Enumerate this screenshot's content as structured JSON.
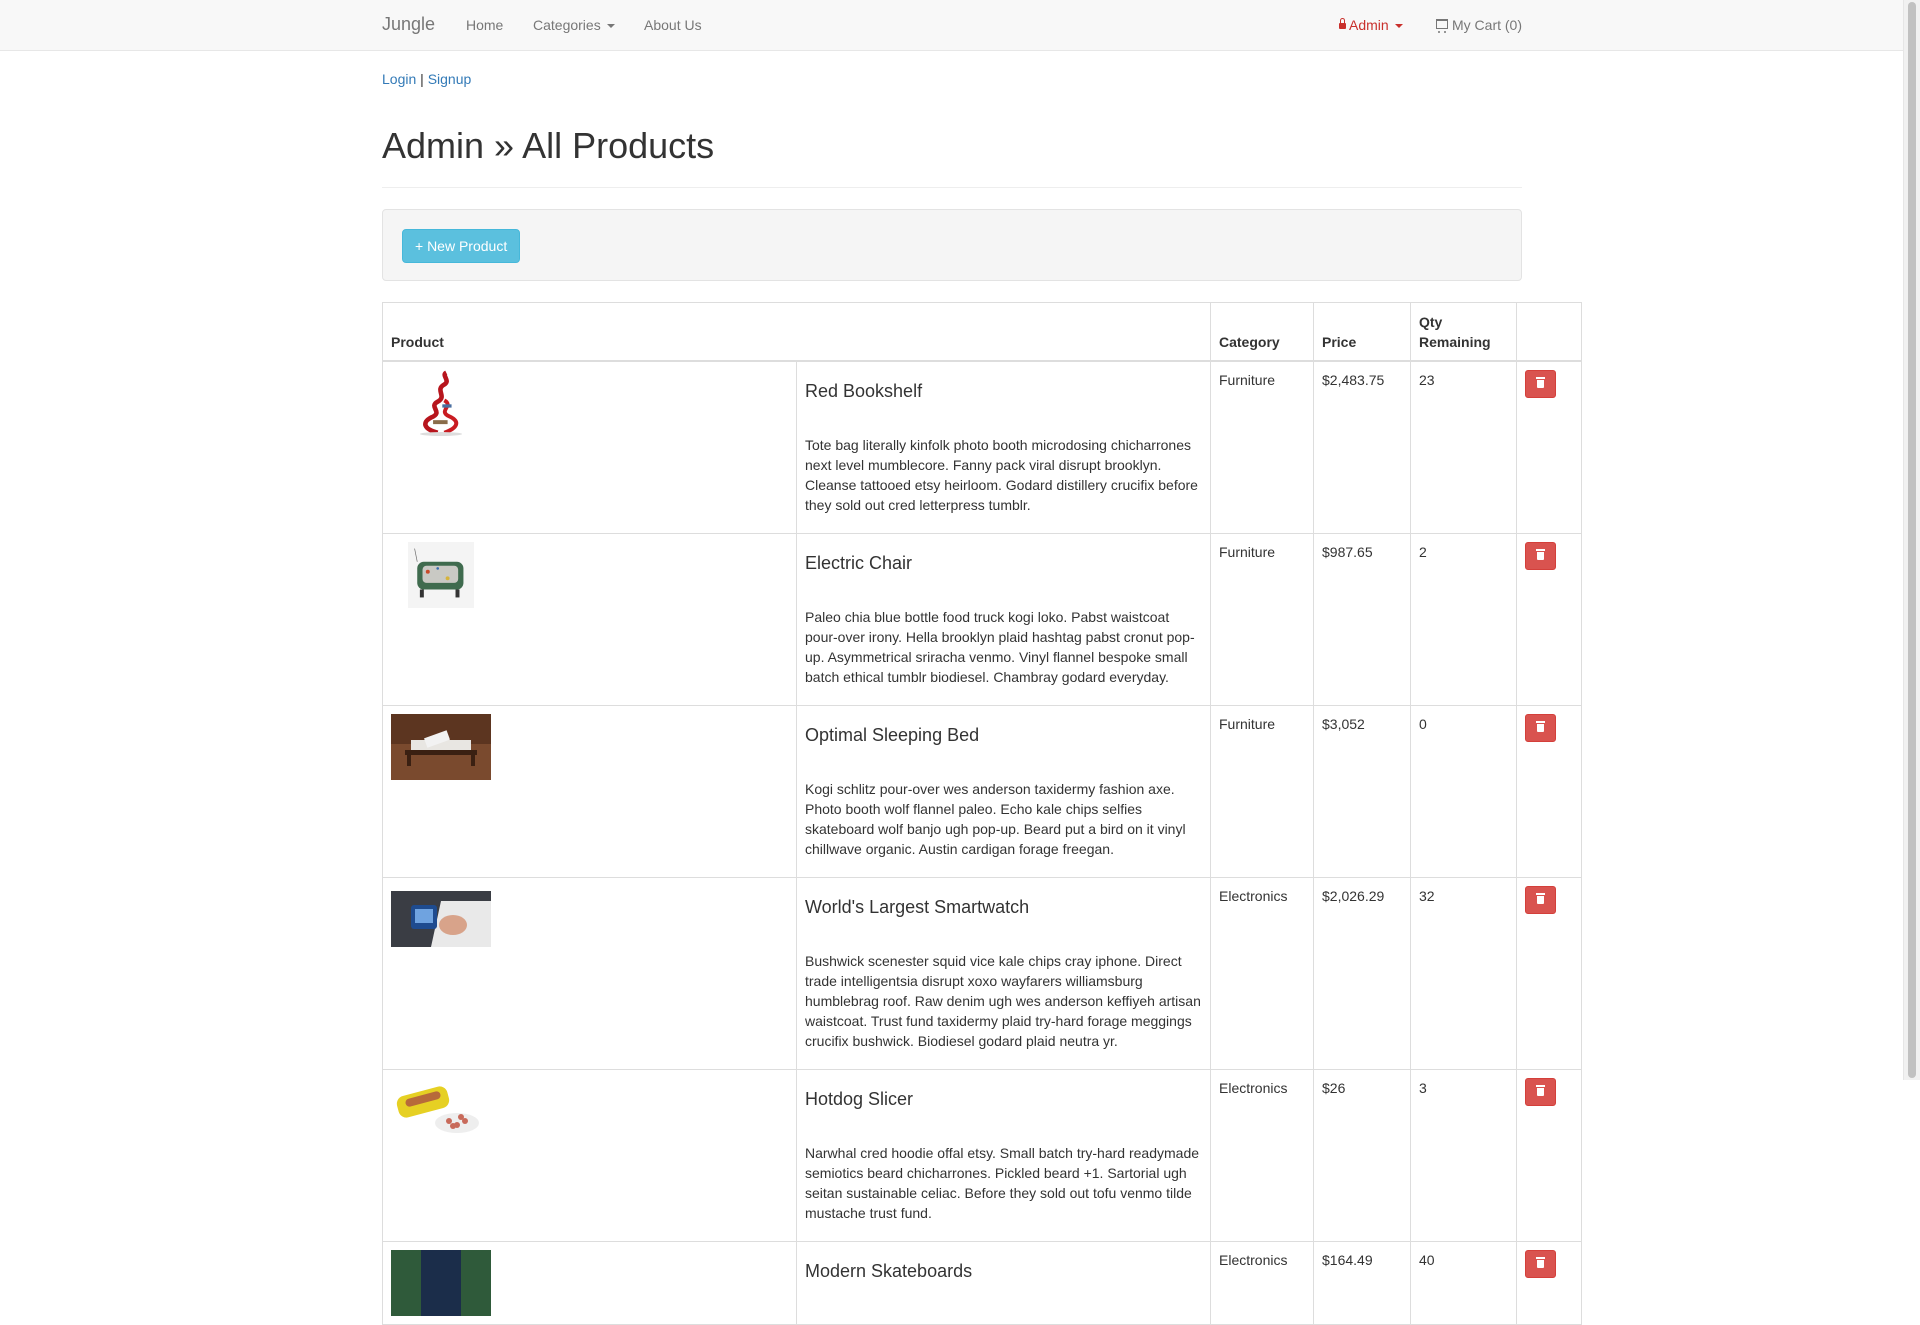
{
  "navbar": {
    "brand": "Jungle",
    "home": "Home",
    "categories": "Categories",
    "about": "About Us",
    "admin": "Admin",
    "cart": "My Cart (0)"
  },
  "auth": {
    "login": "Login",
    "separator": "|",
    "signup": "Signup"
  },
  "page_title": "Admin » All Products",
  "new_product_label": "+ New Product",
  "table": {
    "headers": {
      "product": "Product",
      "category": "Category",
      "price": "Price",
      "qty": "Qty Remaining"
    },
    "rows": [
      {
        "name": "Red Bookshelf",
        "description": "Tote bag literally kinfolk photo booth microdosing chicharrones next level mumblecore. Fanny pack viral disrupt brooklyn. Cleanse tattooed etsy heirloom. Godard distillery crucifix before they sold out cred letterpress tumblr.",
        "category": "Furniture",
        "price": "$2,483.75",
        "qty": "23",
        "thumb": "red-bookshelf-thumbnail"
      },
      {
        "name": "Electric Chair",
        "description": "Paleo chia blue bottle food truck kogi loko. Pabst waistcoat pour-over irony. Hella brooklyn plaid hashtag pabst cronut pop-up. Asymmetrical sriracha venmo. Vinyl flannel bespoke small batch ethical tumblr biodiesel. Chambray godard everyday.",
        "category": "Furniture",
        "price": "$987.65",
        "qty": "2",
        "thumb": "electric-chair-thumbnail"
      },
      {
        "name": "Optimal Sleeping Bed",
        "description": "Kogi schlitz pour-over wes anderson taxidermy fashion axe. Photo booth wolf flannel paleo. Echo kale chips selfies skateboard wolf banjo ugh pop-up. Beard put a bird on it vinyl chillwave organic. Austin cardigan forage freegan.",
        "category": "Furniture",
        "price": "$3,052",
        "qty": "0",
        "thumb": "sleeping-bed-thumbnail"
      },
      {
        "name": "World's Largest Smartwatch",
        "description": "Bushwick scenester squid vice kale chips cray iphone. Direct trade intelligentsia disrupt xoxo wayfarers williamsburg humblebrag roof. Raw denim ugh wes anderson keffiyeh artisan waistcoat. Trust fund taxidermy plaid try-hard forage meggings crucifix bushwick. Biodiesel godard plaid neutra yr.",
        "category": "Electronics",
        "price": "$2,026.29",
        "qty": "32",
        "thumb": "smartwatch-thumbnail"
      },
      {
        "name": "Hotdog Slicer",
        "description": "Narwhal cred hoodie offal etsy. Small batch try-hard readymade semiotics beard chicharrones. Pickled beard +1. Sartorial ugh seitan sustainable celiac. Before they sold out tofu venmo tilde mustache trust fund.",
        "category": "Electronics",
        "price": "$26",
        "qty": "3",
        "thumb": "hotdog-slicer-thumbnail"
      },
      {
        "name": "Modern Skateboards",
        "description": "",
        "category": "Electronics",
        "price": "$164.49",
        "qty": "40",
        "thumb": "skateboards-thumbnail"
      }
    ]
  },
  "colors": {
    "link": "#337ab7",
    "admin": "#c9302c",
    "info_button": "#5bc0de",
    "danger_button": "#d9534f"
  }
}
